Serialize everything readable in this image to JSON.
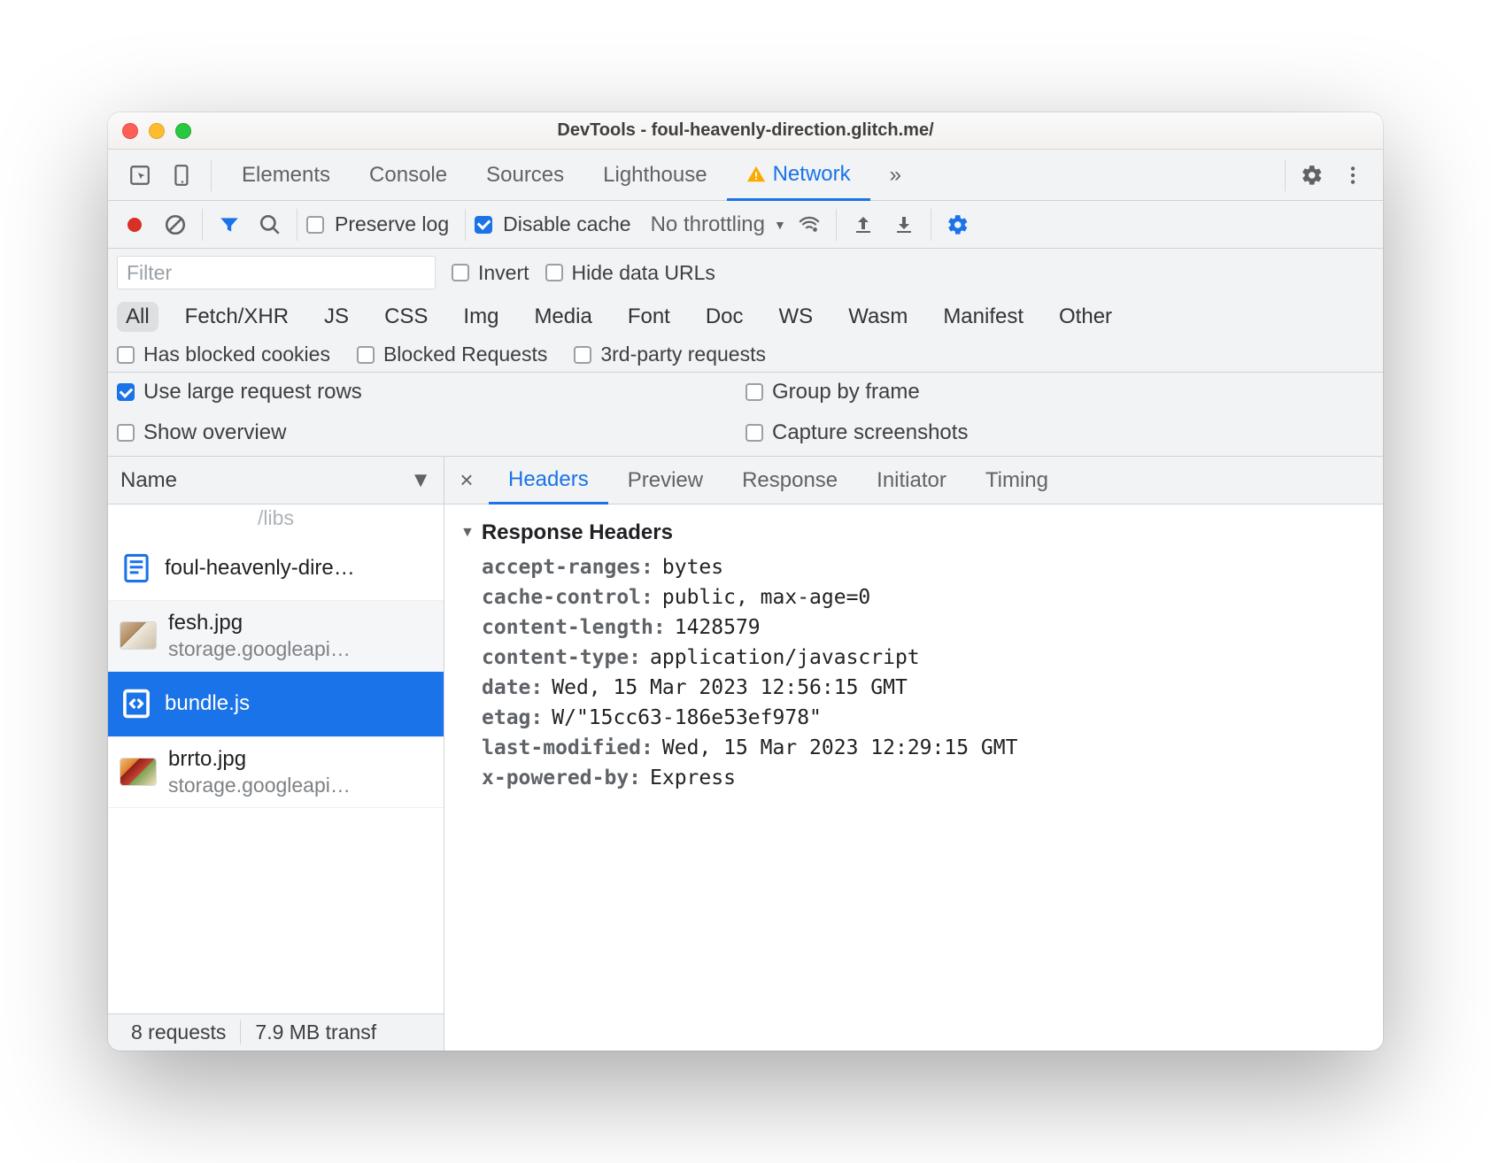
{
  "window": {
    "title": "DevTools - foul-heavenly-direction.glitch.me/"
  },
  "tabs": {
    "items": [
      "Elements",
      "Console",
      "Sources",
      "Lighthouse",
      "Network"
    ],
    "active": "Network",
    "overflow": "»"
  },
  "toolbar": {
    "preserve_log": "Preserve log",
    "disable_cache": "Disable cache",
    "throttling": "No throttling"
  },
  "filter": {
    "placeholder": "Filter",
    "invert": "Invert",
    "hide_data": "Hide data URLs"
  },
  "types": [
    "All",
    "Fetch/XHR",
    "JS",
    "CSS",
    "Img",
    "Media",
    "Font",
    "Doc",
    "WS",
    "Wasm",
    "Manifest",
    "Other"
  ],
  "type_active": "All",
  "row3": {
    "blocked_cookies": "Has blocked cookies",
    "blocked_requests": "Blocked Requests",
    "third_party": "3rd-party requests"
  },
  "row4": {
    "large_rows": "Use large request rows",
    "group_by_frame": "Group by frame",
    "show_overview": "Show overview",
    "capture_ss": "Capture screenshots"
  },
  "left": {
    "header": "Name",
    "ghost": "/libs",
    "requests": [
      {
        "name": "foul-heavenly-dire…",
        "sub": "",
        "icon": "doc",
        "selected": false,
        "alt": false
      },
      {
        "name": "fesh.jpg",
        "sub": "storage.googleapi…",
        "icon": "thumb1",
        "selected": false,
        "alt": true
      },
      {
        "name": "bundle.js",
        "sub": "",
        "icon": "script",
        "selected": true,
        "alt": false
      },
      {
        "name": "brrto.jpg",
        "sub": "storage.googleapi…",
        "icon": "thumb2",
        "selected": false,
        "alt": false
      }
    ]
  },
  "status": {
    "requests": "8 requests",
    "transfer": "7.9 MB transf"
  },
  "right_tabs": [
    "Headers",
    "Preview",
    "Response",
    "Initiator",
    "Timing"
  ],
  "right_tab_active": "Headers",
  "headers": {
    "section": "Response Headers",
    "items": [
      {
        "k": "accept-ranges:",
        "v": "bytes"
      },
      {
        "k": "cache-control:",
        "v": "public, max-age=0"
      },
      {
        "k": "content-length:",
        "v": "1428579"
      },
      {
        "k": "content-type:",
        "v": "application/javascript"
      },
      {
        "k": "date:",
        "v": "Wed, 15 Mar 2023 12:56:15 GMT"
      },
      {
        "k": "etag:",
        "v": "W/\"15cc63-186e53ef978\""
      },
      {
        "k": "last-modified:",
        "v": "Wed, 15 Mar 2023 12:29:15 GMT"
      },
      {
        "k": "x-powered-by:",
        "v": "Express"
      }
    ]
  }
}
